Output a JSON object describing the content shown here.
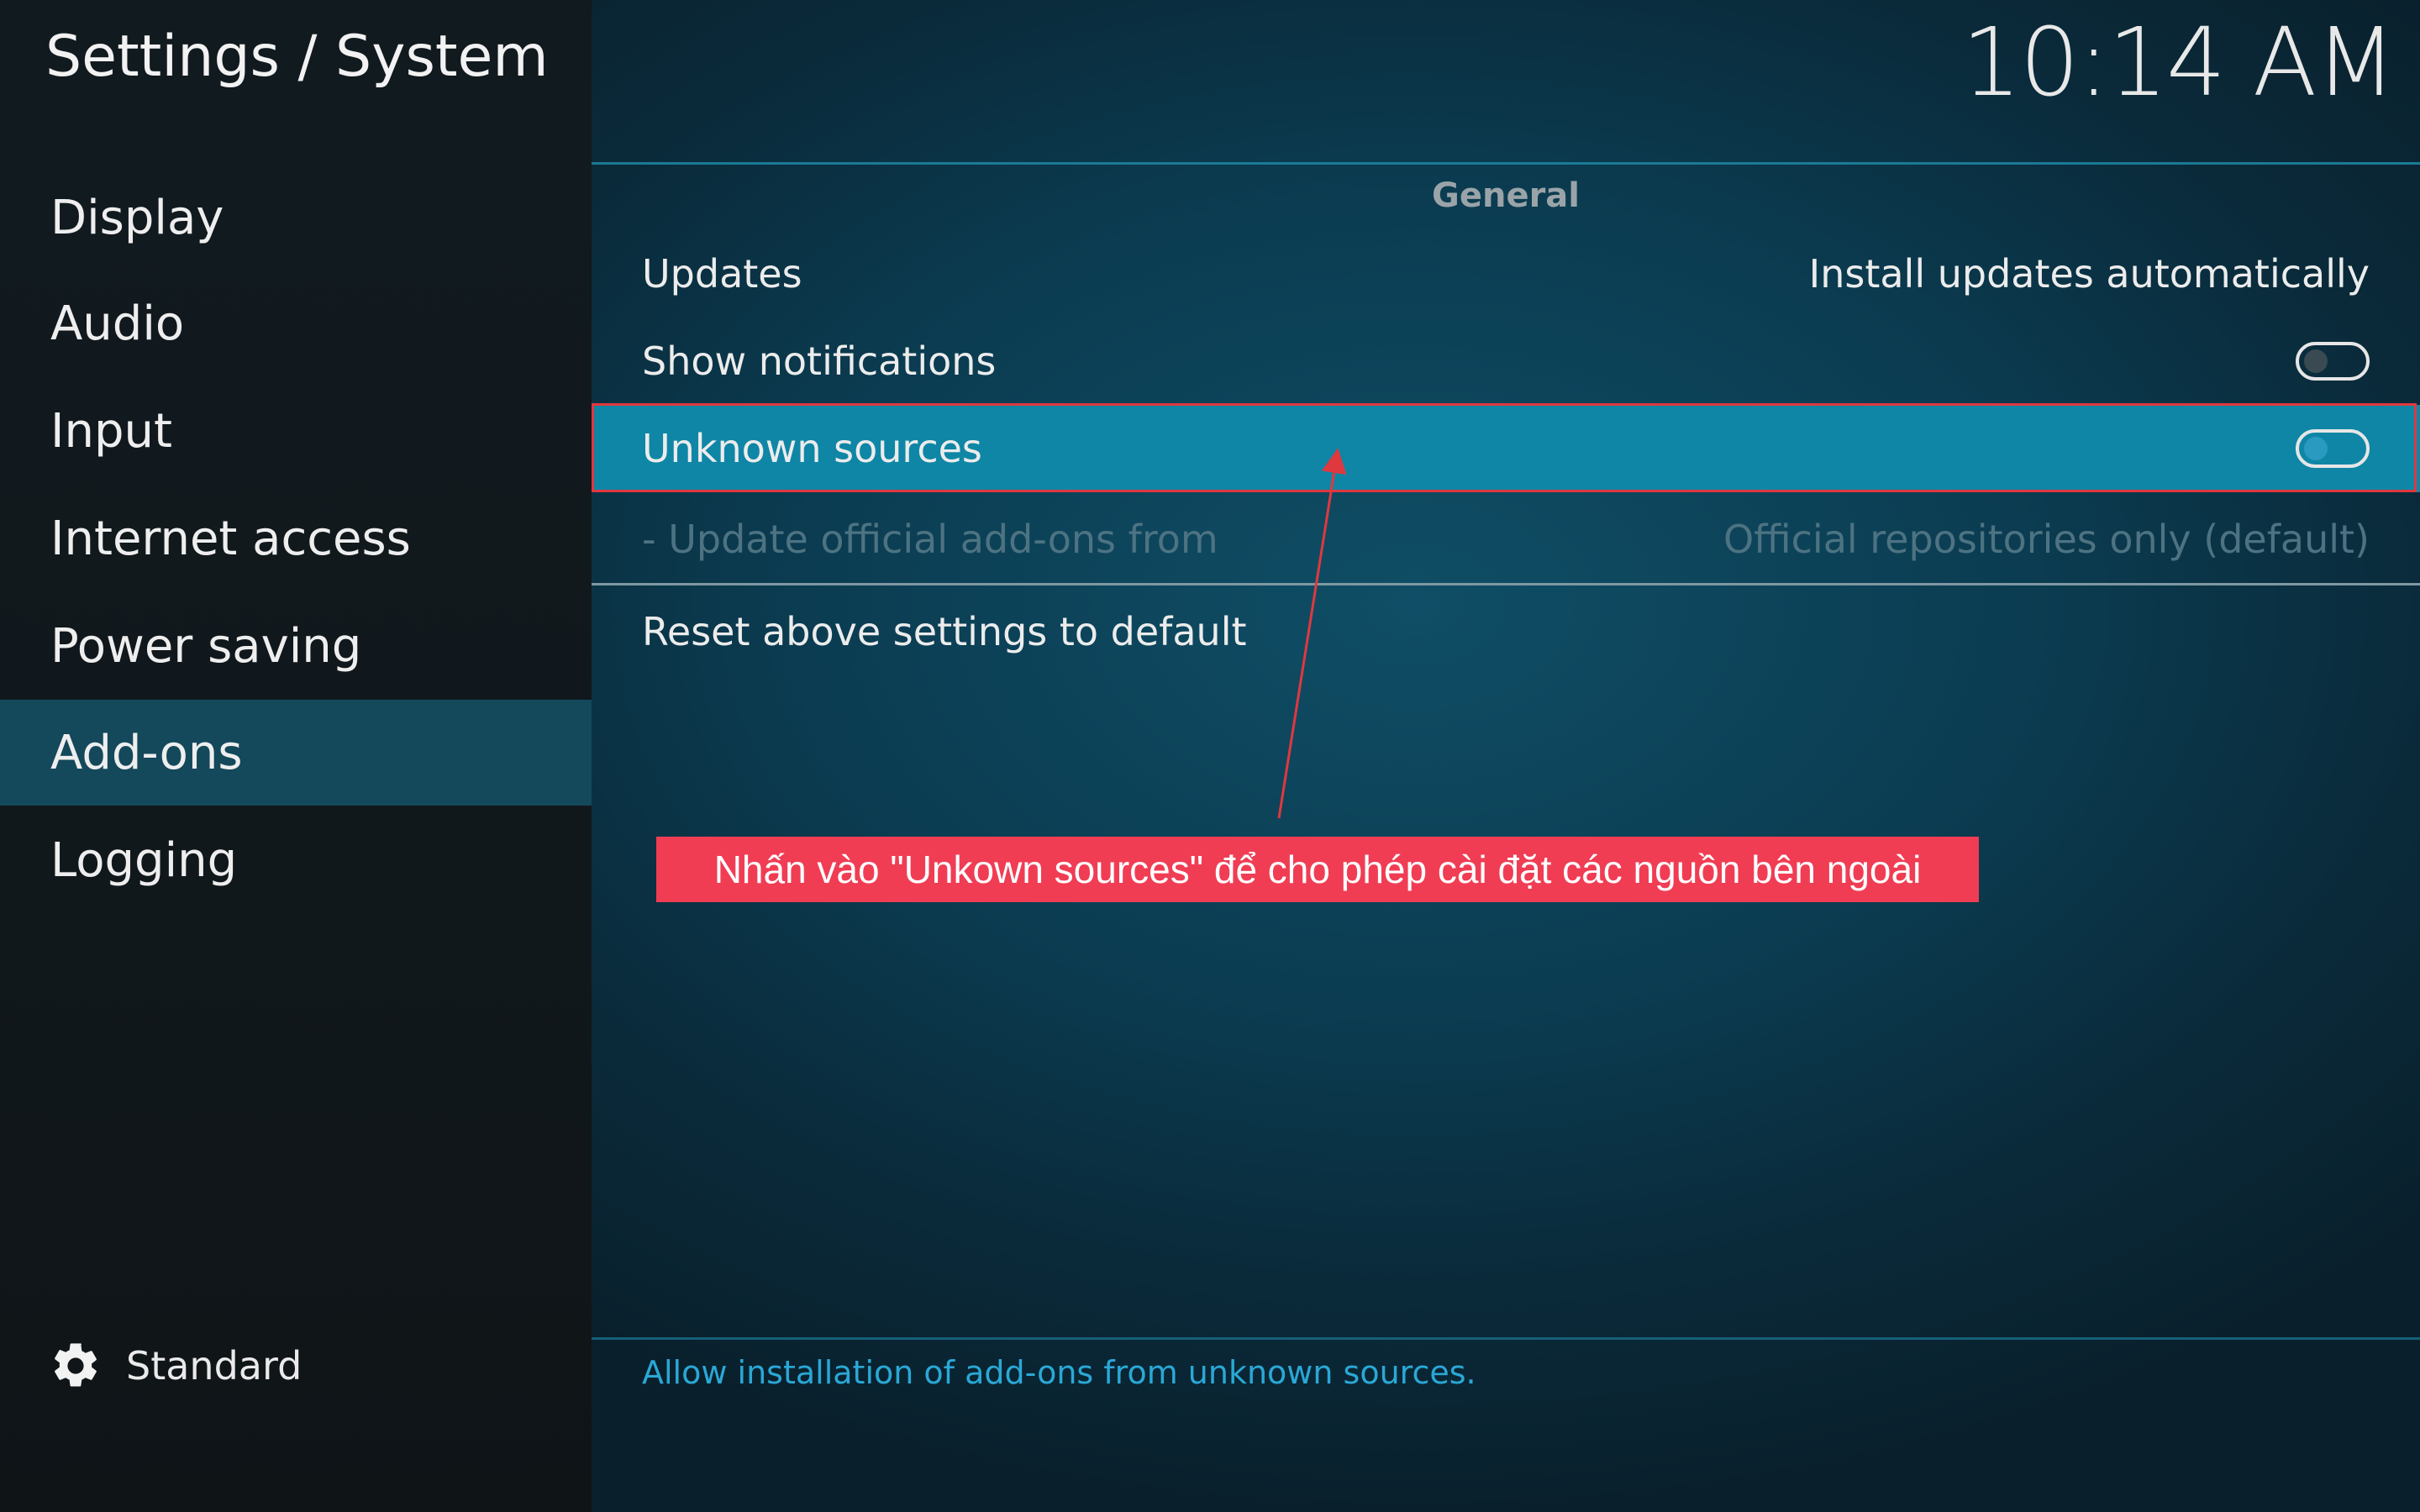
{
  "header": {
    "title": "Settings / System",
    "clock": "10:14 AM"
  },
  "sidebar": {
    "items": [
      {
        "label": "Display"
      },
      {
        "label": "Audio"
      },
      {
        "label": "Input"
      },
      {
        "label": "Internet access"
      },
      {
        "label": "Power saving"
      },
      {
        "label": "Add-ons",
        "active": true
      },
      {
        "label": "Logging"
      }
    ],
    "footer": {
      "icon": "gear-icon",
      "label": "Standard"
    }
  },
  "main": {
    "section_title": "General",
    "settings": [
      {
        "label": "Updates",
        "value": "Install updates automatically"
      },
      {
        "label": "Show notifications",
        "toggle": "off"
      },
      {
        "label": "Unknown sources",
        "toggle": "off",
        "focused": true
      },
      {
        "label": "- Update official add-ons from",
        "value": "Official repositories only (default)",
        "disabled": true
      }
    ],
    "reset_label": "Reset above settings to default",
    "help_text": "Allow installation of add-ons from unknown sources."
  },
  "annotation": {
    "callout_text": "Nhấn vào \"Unkown sources\" để cho phép cài đặt các nguồn bên ngoài",
    "color": "#f03d54"
  },
  "colors": {
    "accent": "#0f86a6",
    "sidebar_active": "#14485b",
    "help_text": "#2aa8d6"
  }
}
